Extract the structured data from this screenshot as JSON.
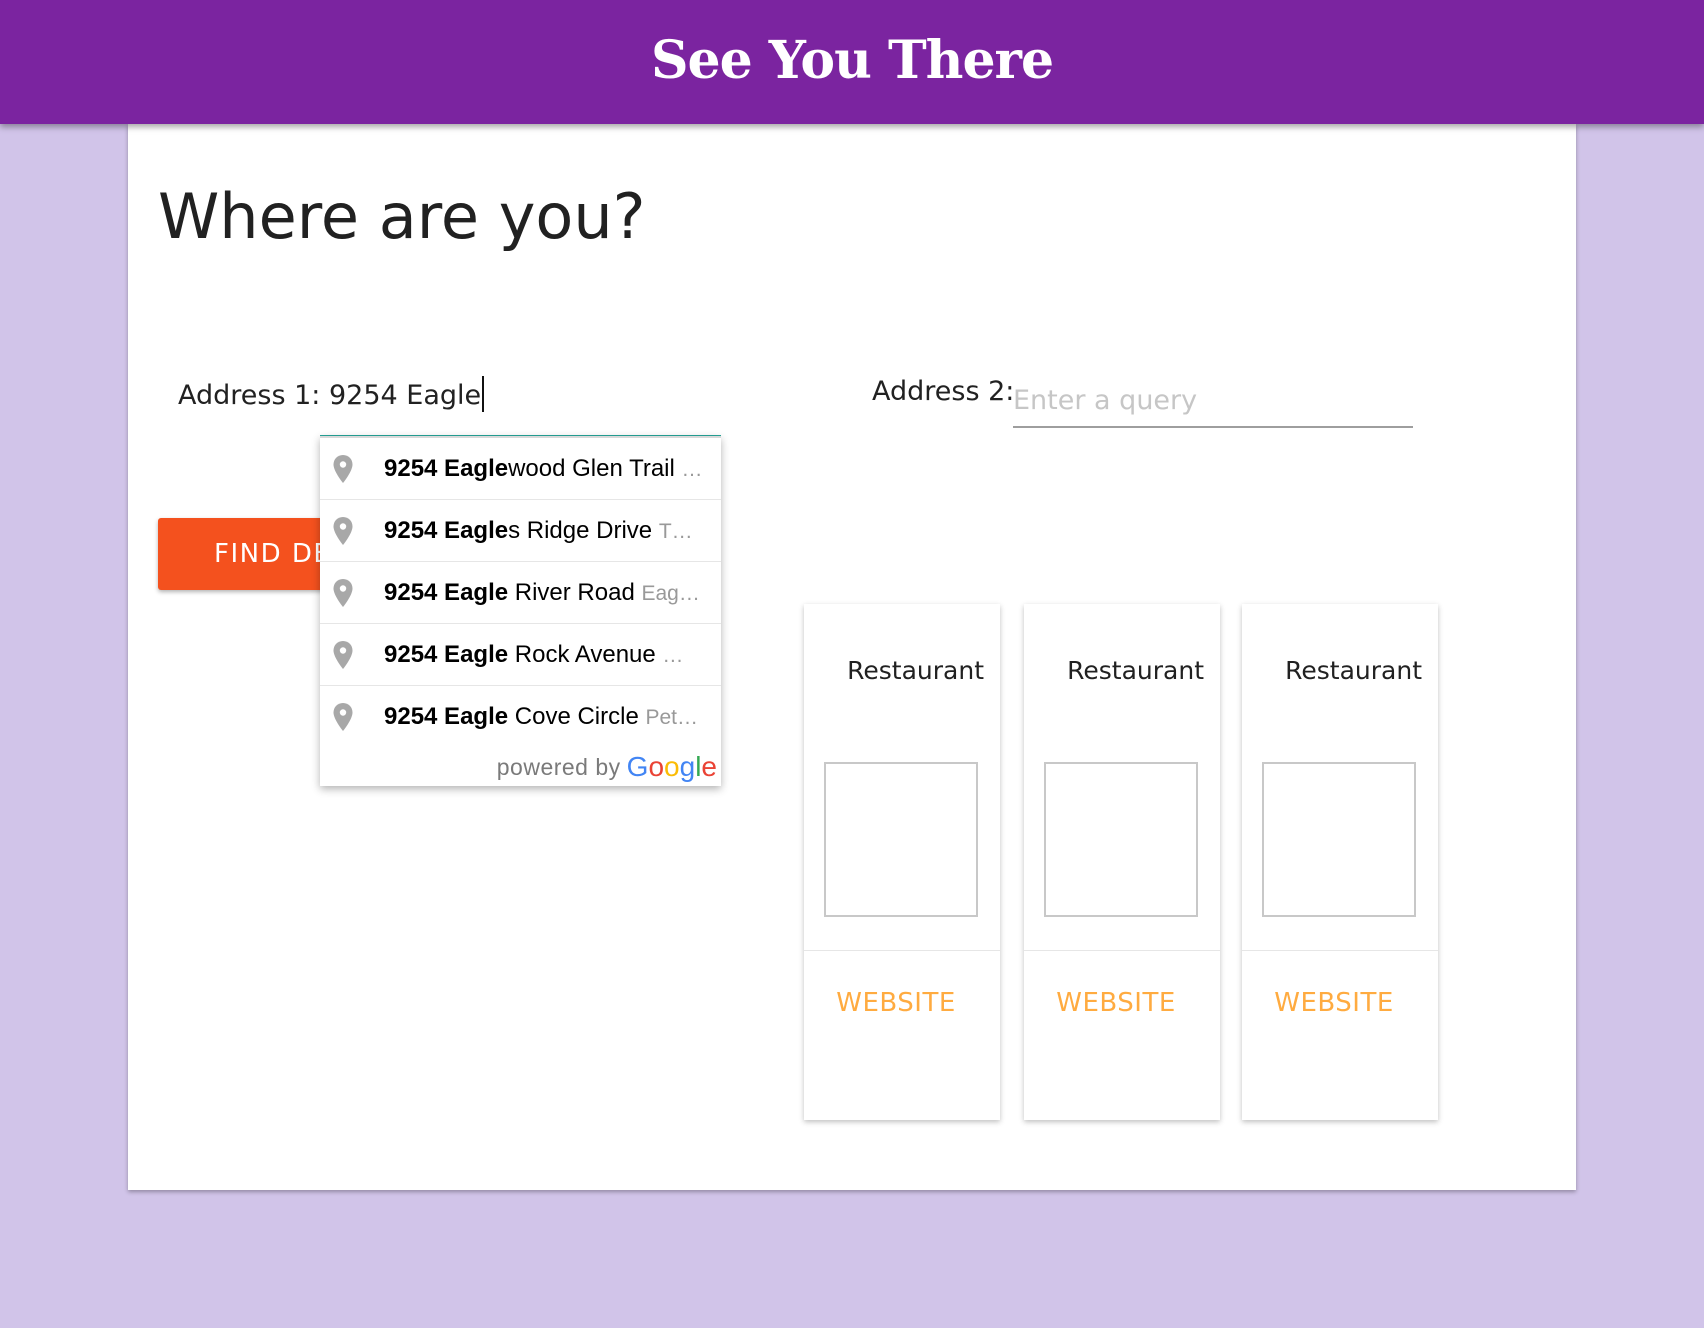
{
  "header": {
    "title": "See You There"
  },
  "page": {
    "title": "Where are you?"
  },
  "address1": {
    "label": "Address 1:",
    "value": "9254 Eagle"
  },
  "address2": {
    "label": "Address 2:",
    "placeholder": "Enter a query"
  },
  "find_button": {
    "label": "FIND DE"
  },
  "autocomplete": {
    "items": [
      {
        "match": "9254 Eagle",
        "rest": "wood Glen Trail",
        "secondary": "…"
      },
      {
        "match": "9254 Eagle",
        "rest": "s Ridge Drive",
        "secondary": "T…"
      },
      {
        "match": "9254 Eagle",
        "rest": " River Road",
        "secondary": "Eag…"
      },
      {
        "match": "9254 Eagle",
        "rest": " Rock Avenue",
        "secondary": "…"
      },
      {
        "match": "9254 Eagle",
        "rest": " Cove Circle",
        "secondary": "Pet…"
      }
    ],
    "powered_by": "powered by",
    "logo_letters": [
      "G",
      "o",
      "o",
      "g",
      "l",
      "e"
    ],
    "logo_colors": [
      "#4285F4",
      "#EA4335",
      "#FBBC05",
      "#4285F4",
      "#34A853",
      "#EA4335"
    ]
  },
  "restaurants": [
    {
      "name": "Restaurant",
      "link": "WEBSITE"
    },
    {
      "name": "Restaurant",
      "link": "WEBSITE"
    },
    {
      "name": "Restaurant",
      "link": "WEBSITE"
    }
  ],
  "colors": {
    "app_bar": "#7b24a0",
    "background": "#d1c4e9",
    "find_button": "#f4511e",
    "website_link": "#ffab40",
    "input_focus": "#26a69a"
  },
  "icons": {
    "autocomplete_item": "map-pin-icon"
  }
}
